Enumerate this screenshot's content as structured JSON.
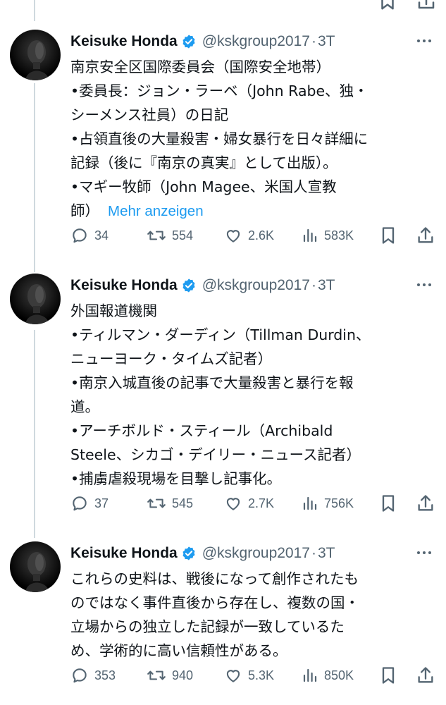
{
  "tweets": [
    {
      "author": {
        "name": "Keisuke Honda",
        "handle": "@kskgroup2017",
        "separator": "·",
        "time": "3T"
      },
      "lines": [
        "南京安全区国際委員会（国際安全地帯）",
        "•委員長：ジョン・ラーベ（John Rabe、独・",
        "シーメンス社員）の日記",
        "•占領直後の大量殺害・婦女暴行を日々詳細に",
        "記録（後に『南京の真実』として出版）。",
        "•マギー牧師（John Magee、米国人宣教",
        "師）"
      ],
      "show_more": "Mehr anzeigen",
      "stats": {
        "replies": "34",
        "reposts": "554",
        "likes": "2.6K",
        "views": "583K"
      }
    },
    {
      "author": {
        "name": "Keisuke Honda",
        "handle": "@kskgroup2017",
        "separator": "·",
        "time": "3T"
      },
      "lines": [
        "外国報道機関",
        "•ティルマン・ダーディン（Tillman Durdin、",
        "ニューヨーク・タイムズ記者）",
        "•南京入城直後の記事で大量殺害と暴行を報",
        "道。",
        "•アーチボルド・スティール（Archibald",
        "Steele、シカゴ・デイリー・ニュース記者）",
        "•捕虜虐殺現場を目撃し記事化。"
      ],
      "stats": {
        "replies": "37",
        "reposts": "545",
        "likes": "2.7K",
        "views": "756K"
      }
    },
    {
      "author": {
        "name": "Keisuke Honda",
        "handle": "@kskgroup2017",
        "separator": "·",
        "time": "3T"
      },
      "lines": [
        "これらの史料は、戦後になって創作されたも",
        "のではなく事件直後から存在し、複数の国・",
        "立場からの独立した記録が一致しているた",
        "め、学術的に高い信頼性がある。"
      ],
      "stats": {
        "replies": "353",
        "reposts": "940",
        "likes": "5.3K",
        "views": "850K"
      }
    }
  ],
  "icons": {
    "reply": "reply-icon",
    "repost": "repost-icon",
    "like": "heart-icon",
    "views": "views-icon",
    "bookmark": "bookmark-icon",
    "share": "share-icon",
    "more": "more-icon",
    "verified": "verified-badge-icon"
  },
  "colors": {
    "text": "#0f1419",
    "muted": "#536471",
    "link": "#1d9bf0",
    "verified": "#1d9bf0",
    "thread_line": "#cfd9de"
  }
}
